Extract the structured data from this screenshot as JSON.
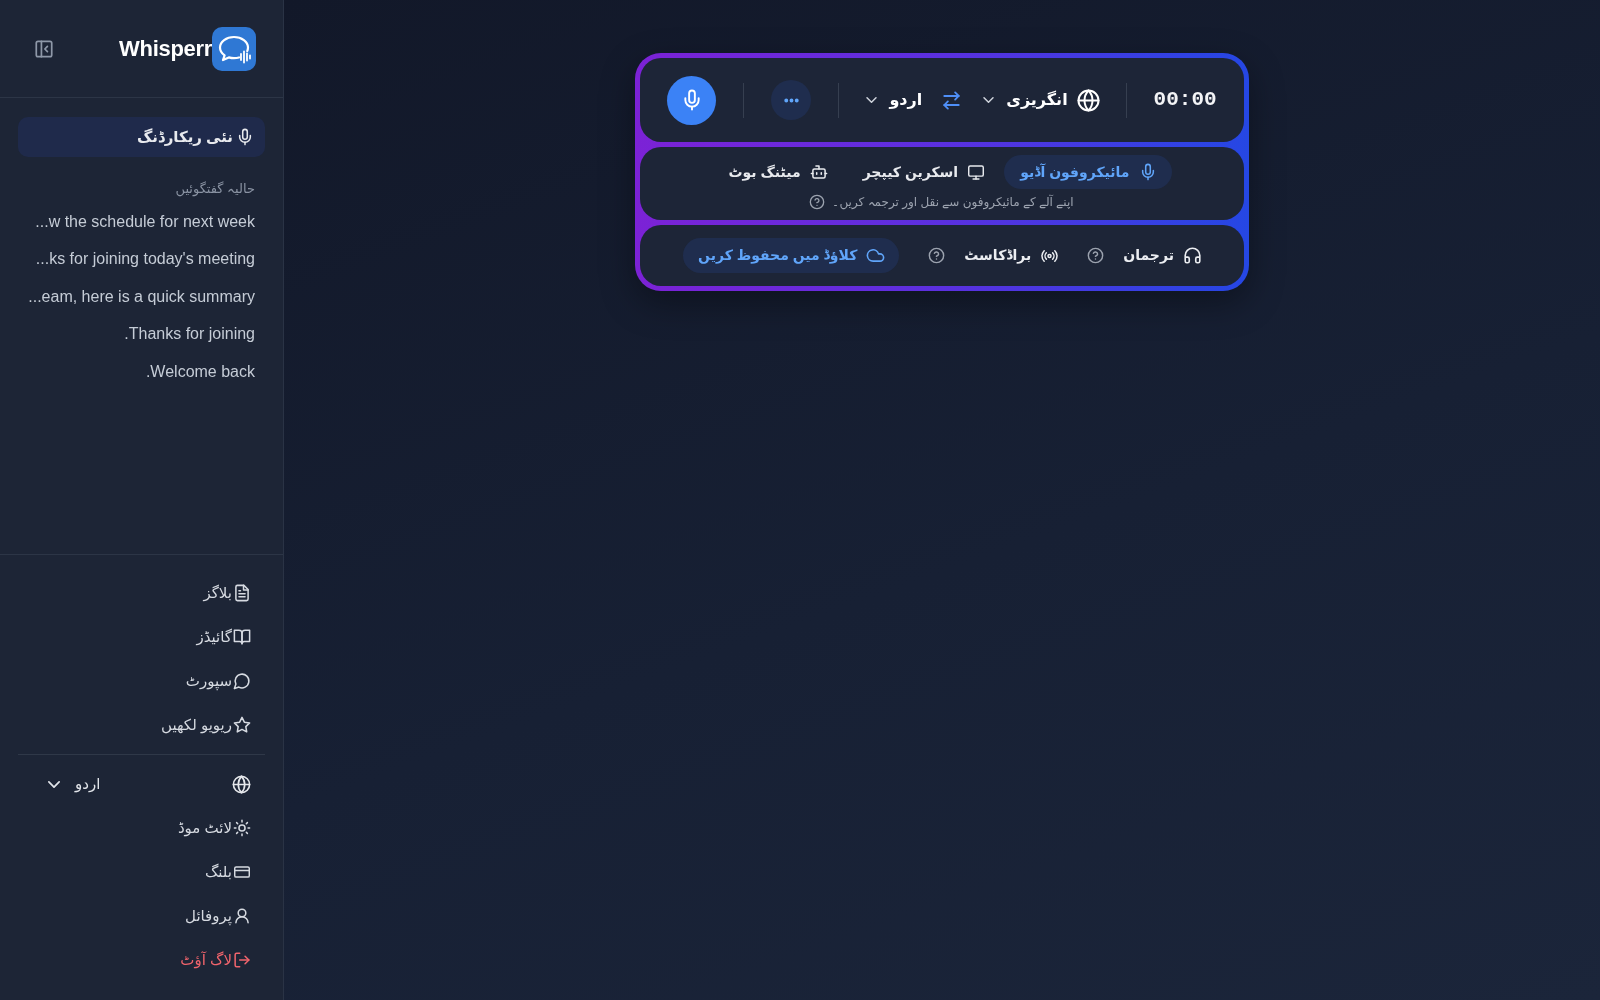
{
  "sidebar": {
    "logo": {
      "text": "Whisperr"
    },
    "new_recording": {
      "label": "نئی ریکارڈنگ"
    },
    "recent_heading": "حالیہ گفتگوئیں",
    "recent_conversations": [
      "...w the schedule for next week",
      "...ks for joining today's meeting",
      "...eam, here is a quick summary",
      ".Thanks for joining",
      ".Welcome back"
    ],
    "links": [
      {
        "label": "بلاگز",
        "kind": "link"
      },
      {
        "label": "گائیڈز",
        "kind": "link"
      },
      {
        "label": "سپورٹ",
        "kind": "link"
      },
      {
        "label": "ریویو لکھیں",
        "kind": "link"
      }
    ],
    "language": {
      "value": "اردو"
    },
    "settings": [
      {
        "label": "لائٹ موڈ",
        "kind": "link"
      },
      {
        "label": "بلنگ",
        "kind": "link"
      },
      {
        "label": "پروفائل",
        "kind": "link"
      },
      {
        "label": "لاگ آؤٹ",
        "kind": "danger"
      }
    ]
  },
  "recorder": {
    "timer": "00:00",
    "source_language": "انگریزی",
    "target_language": "اردو",
    "sources": [
      {
        "label": "مائیکروفون آڈیو",
        "selected": true
      },
      {
        "label": "اسکرین کیپچر",
        "selected": false
      },
      {
        "label": "میٹنگ بوٹ",
        "selected": false
      }
    ],
    "source_hint": "اپنے آلے کے مائیکروفون سے نقل اور ترجمہ کریں۔",
    "options": [
      {
        "label": "ترجمان",
        "on": false,
        "help": true
      },
      {
        "label": "براڈکاسٹ",
        "on": false,
        "help": true
      },
      {
        "label": "کلاؤڈ میں محفوظ کریں",
        "on": true,
        "help": false
      }
    ]
  }
}
